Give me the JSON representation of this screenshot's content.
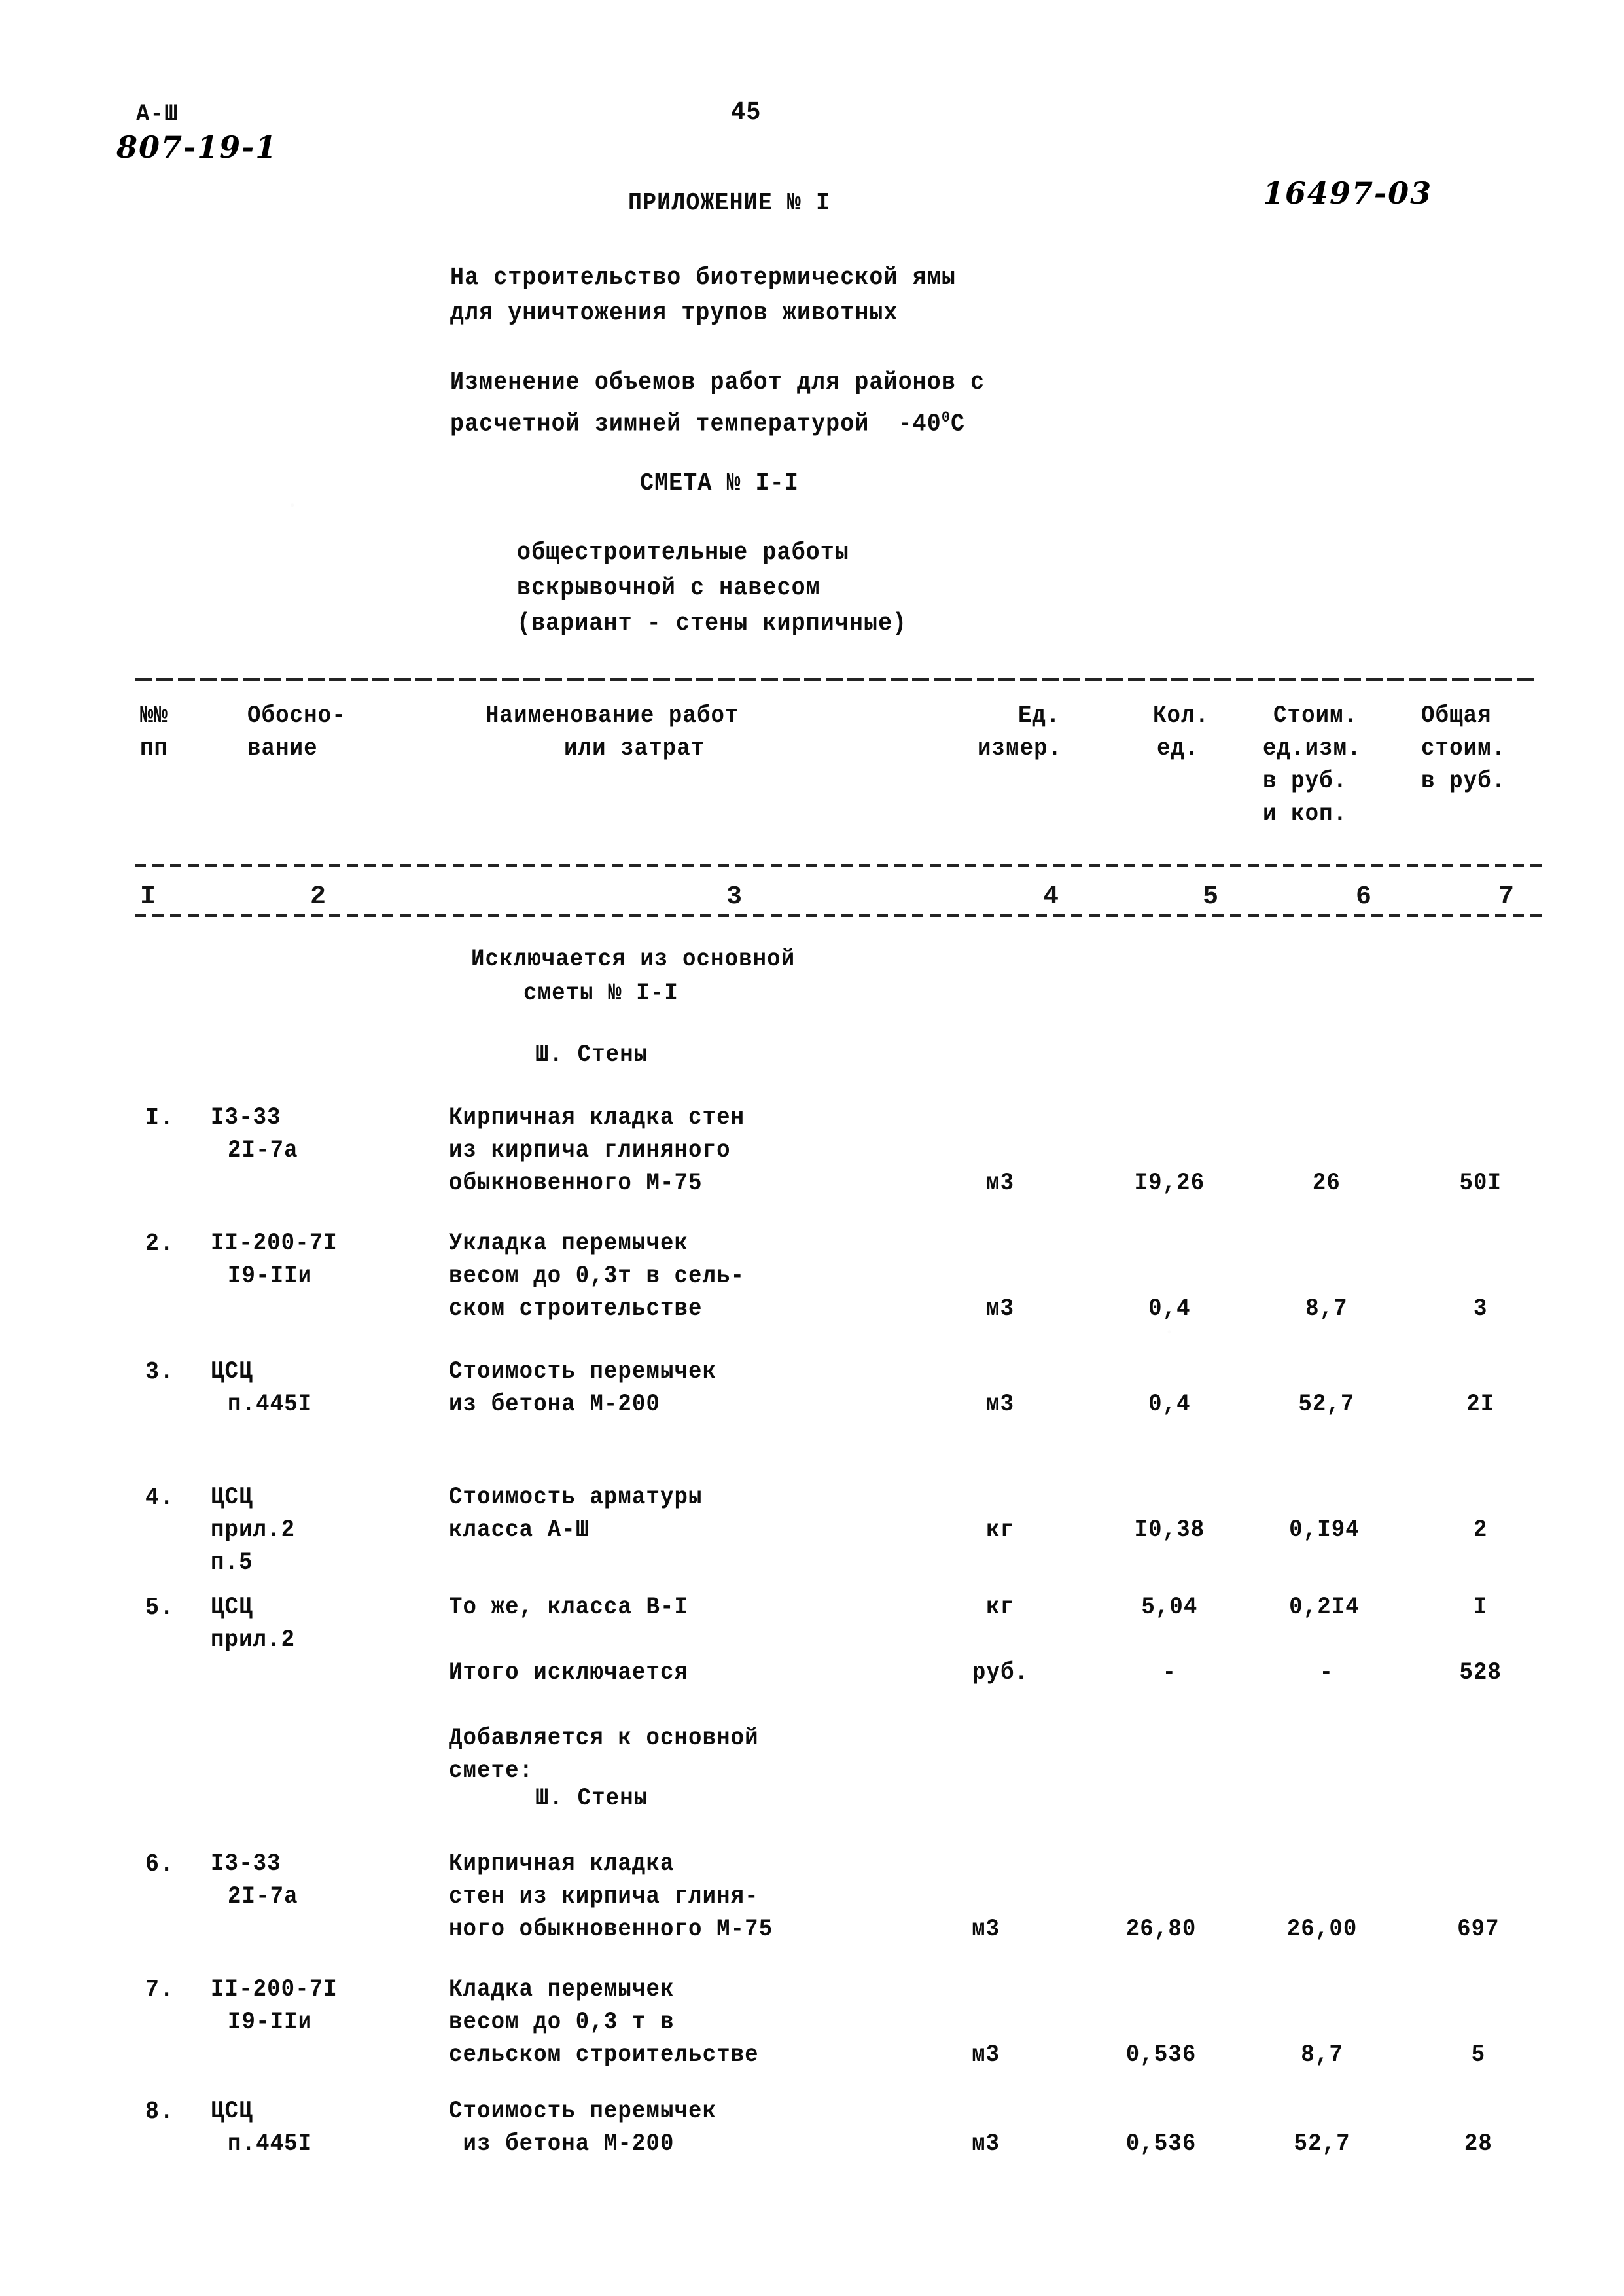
{
  "stamp": {
    "line1": "А-Ш",
    "handwritten_code": "807-19-1"
  },
  "page_number": "45",
  "top_right_handwritten": "16497-03",
  "appendix_title": "ПРИЛОЖЕНИЕ № I",
  "object_title": {
    "line1": "На строительство биотермической ямы",
    "line2": "для уничтожения трупов животных"
  },
  "change_note": {
    "line1": "Изменение объемов работ для районов с",
    "line2_pre": "расчетной зимней температурой  -40",
    "line2_deg": "0",
    "line2_post": "С"
  },
  "estimate_heading": "СМЕТА № I-I",
  "estimate_subtitle": {
    "line1": "общестроительные работы",
    "line2": "вскрывочной с навесом",
    "line3": "(вариант - стены кирпичные)"
  },
  "table": {
    "headers": {
      "col1_l1": "№№",
      "col1_l2": "пп",
      "col2_l1": "Обосно-",
      "col2_l2": "вание",
      "col3_l1": "Наименование работ",
      "col3_l2": "или затрат",
      "col4_l1": "Ед.",
      "col4_l2": "измер.",
      "col5_l1": "Кол.",
      "col5_l2": "ед.",
      "col6_l1": "Стоим.",
      "col6_l2": "ед.изм.",
      "col6_l3": "в руб.",
      "col6_l4": "и коп.",
      "col7_l1": "Общая",
      "col7_l2": "стоим.",
      "col7_l3": "в руб."
    },
    "column_numbers": [
      "I",
      "2",
      "3",
      "4",
      "5",
      "6",
      "7"
    ],
    "section_excluded": {
      "line1": "Исключается из основной",
      "line2": "сметы № I-I",
      "subheading": "Ш. Стены"
    },
    "section_added": {
      "line1": "Добавляется к основной",
      "line2": "смете:",
      "subheading": "Ш. Стены"
    },
    "rows_excluded": [
      {
        "no": "I.",
        "basis": [
          "I3-33",
          "2I-7a"
        ],
        "desc": [
          "Кирпичная кладка стен",
          "из кирпича глиняного",
          "обыкновенного М-75"
        ],
        "unit": "м3",
        "qty": "I9,26",
        "unit_cost": "26",
        "total": "50I"
      },
      {
        "no": "2.",
        "basis": [
          "II-200-7I",
          "I9-IIи"
        ],
        "desc": [
          "Укладка перемычек",
          "весом до 0,3т в сель-",
          "ском строительстве"
        ],
        "unit": "м3",
        "qty": "0,4",
        "unit_cost": "8,7",
        "total": "3"
      },
      {
        "no": "3.",
        "basis": [
          "ЦСЦ",
          "п.445I"
        ],
        "desc": [
          "Стоимость перемычек",
          "из бетона М-200"
        ],
        "unit": "м3",
        "qty": "0,4",
        "unit_cost": "52,7",
        "total": "2I"
      },
      {
        "no": "4.",
        "basis": [
          "ЦСЦ",
          "прил.2",
          "п.5"
        ],
        "desc": [
          "Стоимость арматуры",
          "класса А-Ш"
        ],
        "unit": "кг",
        "qty": "I0,38",
        "unit_cost": "0,I94",
        "total": "2"
      },
      {
        "no": "5.",
        "basis": [
          "ЦСЦ",
          "прил.2"
        ],
        "desc": [
          "То же, класса В-I"
        ],
        "unit": "кг",
        "qty": "5,04",
        "unit_cost": "0,2I4",
        "total": "I"
      }
    ],
    "subtotal_excluded": {
      "label": "Итого исключается",
      "unit": "руб.",
      "qty": "-",
      "unit_cost": "-",
      "total": "528"
    },
    "rows_added": [
      {
        "no": "6.",
        "basis": [
          "I3-33",
          "2I-7a"
        ],
        "desc": [
          "Кирпичная кладка",
          "стен из кирпича глиня-",
          "ного обыкновенного М-75"
        ],
        "unit": "м3",
        "qty": "26,80",
        "unit_cost": "26,00",
        "total": "697"
      },
      {
        "no": "7.",
        "basis": [
          "II-200-7I",
          "I9-IIи"
        ],
        "desc": [
          "Кладка перемычек",
          "весом до 0,3 т в",
          "сельском строительстве"
        ],
        "unit": "м3",
        "qty": "0,536",
        "unit_cost": "8,7",
        "total": "5"
      },
      {
        "no": "8.",
        "basis": [
          "ЦСЦ",
          "п.445I"
        ],
        "desc": [
          "Стоимость перемычек",
          " из бетона М-200"
        ],
        "unit": "м3",
        "qty": "0,536",
        "unit_cost": "52,7",
        "total": "28"
      }
    ]
  }
}
